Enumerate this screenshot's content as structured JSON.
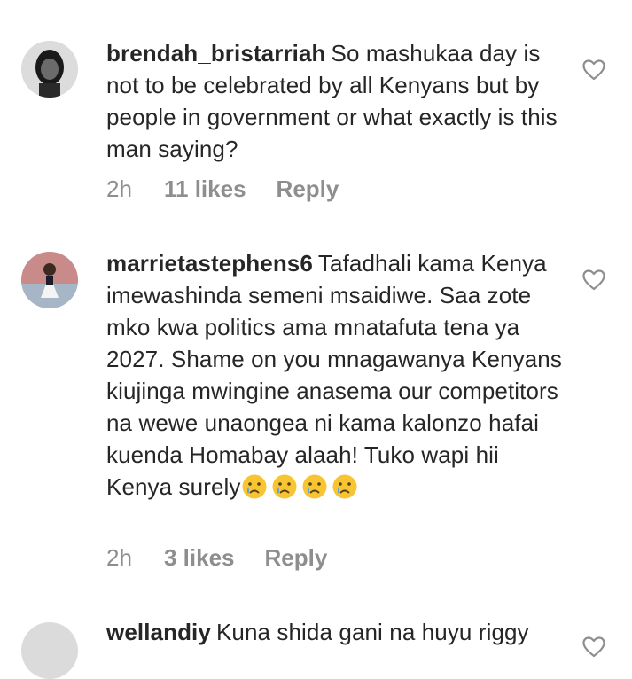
{
  "comments": [
    {
      "username": "brendah_bristarriah",
      "text": "So mashukaa day is not to be celebrated by  all Kenyans but by people in government or what exactly is this man saying?",
      "time": "2h",
      "likes": "11 likes",
      "reply": "Reply"
    },
    {
      "username": "marrietastephens6",
      "text": "Tafadhali kama Kenya imewashinda semeni msaidiwe. Saa zote mko kwa politics ama mnatafuta tena ya 2027. Shame on you mnagawanya Kenyans kiujinga mwingine anasema our competitors na wewe unaongea ni kama kalonzo hafai kuenda Homabay alaah! Tuko wapi hii Kenya surely",
      "emojis": [
        "crying-face-emoji",
        "crying-face-emoji",
        "crying-face-emoji",
        "crying-face-emoji"
      ],
      "time": "2h",
      "likes": "3 likes",
      "reply": "Reply"
    },
    {
      "username": "wellandiy",
      "text": "Kuna shida gani na huyu riggy"
    }
  ],
  "icons": {
    "like": "heart-outline-icon"
  },
  "colors": {
    "text": "#262626",
    "meta": "#8e8e8e",
    "heart": "#8e8e8e"
  }
}
